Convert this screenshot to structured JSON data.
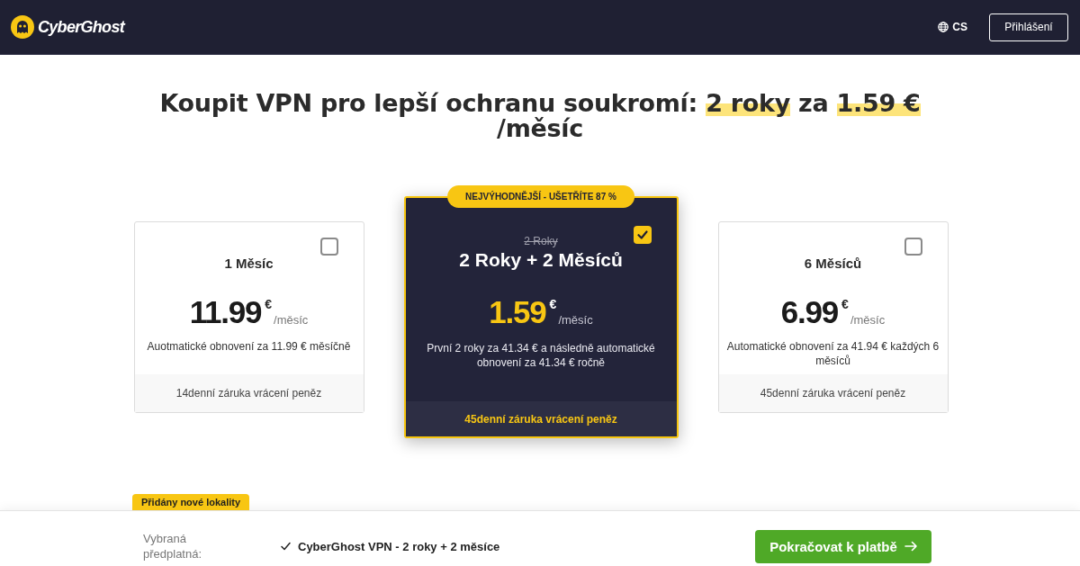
{
  "header": {
    "logo_text": "CyberGhost",
    "language": "CS",
    "login_button": "Přihlášení"
  },
  "headline": [
    {
      "text": "Koupit VPN pro lepší ochranu soukromí: ",
      "highlighted": false
    },
    {
      "text": "2 roky",
      "highlighted": true
    },
    {
      "text": " za ",
      "highlighted": false
    },
    {
      "text": "1.59 €",
      "highlighted": true
    },
    {
      "text": " /měsíc",
      "highlighted": false
    }
  ],
  "plans": [
    {
      "name": "1 Měsíc",
      "price": "11.99",
      "currency": "€",
      "period": "/měsíc",
      "renewal": "Auotmatické obnovení za 11.99 € měsíčně",
      "guarantee": "14denní záruka vrácení peněz",
      "selected": false
    },
    {
      "badge": "NEJVÝHODNĚJŠÍ - UŠETŘÍTE 87 %",
      "previous_name": "2 Roky",
      "name": "2 Roky + 2 Měsíců",
      "price": "1.59",
      "currency": "€",
      "period": "/měsíc",
      "renewal": "První 2 roky za 41.34 € a následně automatické obnovení za 41.34 € ročně",
      "guarantee": "45denní záruka vrácení peněz",
      "selected": true
    },
    {
      "name": "6 Měsíců",
      "price": "6.99",
      "currency": "€",
      "period": "/měsíc",
      "renewal": "Automatické obnovení za 41.94 € každých 6 měsíců",
      "guarantee": "45denní záruka vrácení peněz",
      "selected": false
    }
  ],
  "checkout": {
    "tag": "Přidány nové lokality",
    "label": "Vybraná předplatná:",
    "selection": "CyberGhost VPN - 2 roky + 2 měsíce",
    "button": "Pokračovat k platbě"
  }
}
